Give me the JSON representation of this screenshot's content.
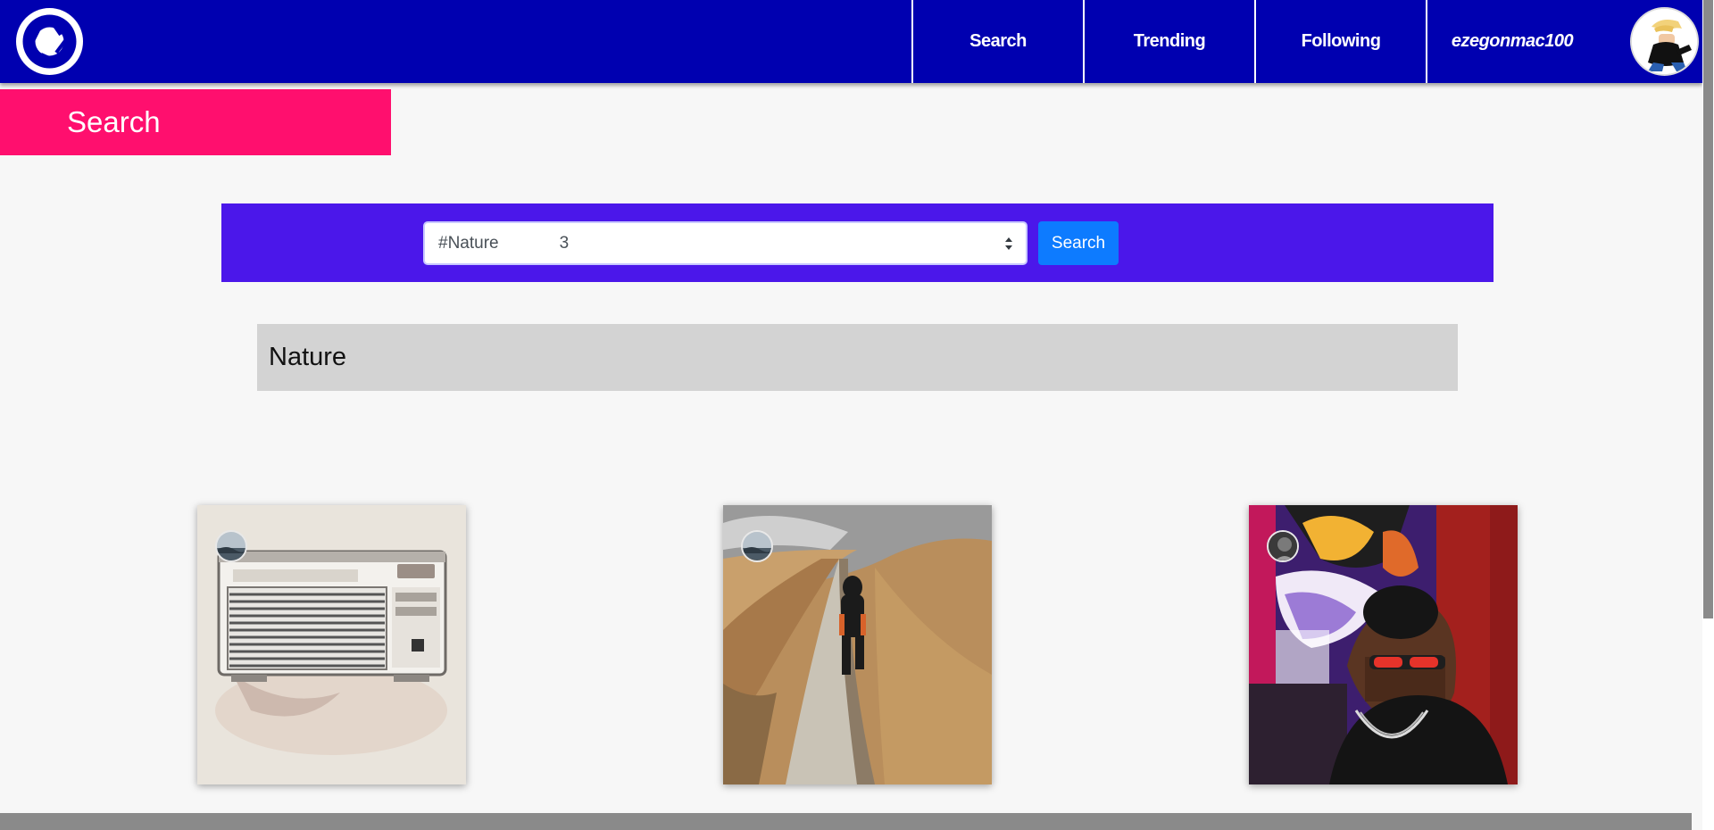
{
  "nav": {
    "links": [
      {
        "label": "Search"
      },
      {
        "label": "Trending"
      },
      {
        "label": "Following"
      },
      {
        "label": "ezegonmac100"
      }
    ]
  },
  "banner": {
    "title": "Search"
  },
  "search": {
    "selected_tag": "#Nature",
    "selected_count": "3",
    "button_label": "Search"
  },
  "results": {
    "tag_title": "Nature",
    "cards": [
      {
        "subject": "vintage radio"
      },
      {
        "subject": "hiker on mountain trail"
      },
      {
        "subject": "man with sunglasses"
      }
    ]
  },
  "colors": {
    "navbar": "#0000b0",
    "banner": "#ff0f6e",
    "search_bar": "#4b17ea",
    "search_button": "#0d7bff",
    "tag_header": "#d3d3d3"
  }
}
